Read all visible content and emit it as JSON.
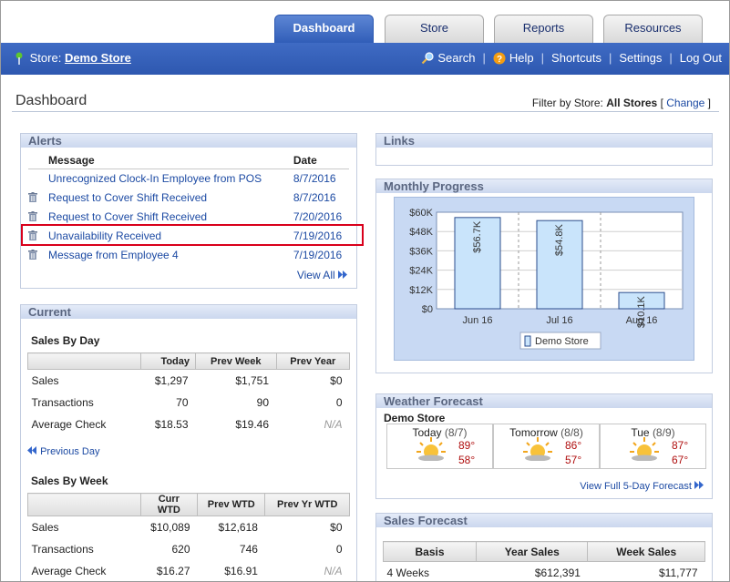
{
  "tabs": [
    {
      "label": "Dashboard",
      "active": true
    },
    {
      "label": "Store",
      "active": false
    },
    {
      "label": "Reports",
      "active": false
    },
    {
      "label": "Resources",
      "active": false
    }
  ],
  "topbar": {
    "store_prefix": "Store:",
    "store_name": "Demo Store",
    "links": [
      "Search",
      "Help",
      "Shortcuts",
      "Settings",
      "Log Out"
    ]
  },
  "page": {
    "title": "Dashboard",
    "filter_label": "Filter by Store:",
    "filter_value": "All Stores",
    "filter_open": "[",
    "filter_change": "Change",
    "filter_close": "]"
  },
  "alerts": {
    "title": "Alerts",
    "col_message": "Message",
    "col_date": "Date",
    "rows": [
      {
        "message": "Unrecognized Clock-In Employee from POS",
        "date": "8/7/2016",
        "trash": false
      },
      {
        "message": "Request to Cover Shift Received",
        "date": "8/7/2016",
        "trash": true
      },
      {
        "message": "Request to Cover Shift Received",
        "date": "7/20/2016",
        "trash": true
      },
      {
        "message": "Unavailability Received",
        "date": "7/19/2016",
        "trash": true,
        "highlight": true
      },
      {
        "message": "Message from Employee 4",
        "date": "7/19/2016",
        "trash": true
      }
    ],
    "view_all": "View All"
  },
  "current": {
    "title": "Current",
    "by_day": {
      "title": "Sales By Day",
      "headers": [
        "",
        "Today",
        "Prev Week",
        "Prev Year"
      ],
      "rows": [
        [
          "Sales",
          "$1,297",
          "$1,751",
          "$0"
        ],
        [
          "Transactions",
          "70",
          "90",
          "0"
        ],
        [
          "Average Check",
          "$18.53",
          "$19.46",
          "N/A"
        ]
      ],
      "prev_link": "Previous Day"
    },
    "by_week": {
      "title": "Sales By Week",
      "headers": [
        "",
        "Curr WTD",
        "Prev WTD",
        "Prev Yr WTD"
      ],
      "rows": [
        [
          "Sales",
          "$10,089",
          "$12,618",
          "$0"
        ],
        [
          "Transactions",
          "620",
          "746",
          "0"
        ],
        [
          "Average Check",
          "$16.27",
          "$16.91",
          "N/A"
        ]
      ]
    }
  },
  "links": {
    "title": "Links"
  },
  "monthly": {
    "title": "Monthly Progress",
    "legend": "Demo Store"
  },
  "chart_data": {
    "type": "bar",
    "categories": [
      "Jun 16",
      "Jul 16",
      "Aug 16"
    ],
    "series": [
      {
        "name": "Demo Store",
        "values": [
          56.7,
          54.8,
          10.1
        ]
      }
    ],
    "value_labels": [
      "$56.7K",
      "$54.8K",
      "$10.1K"
    ],
    "y_ticks": [
      "$0",
      "$12K",
      "$24K",
      "$36K",
      "$48K",
      "$60K"
    ],
    "ylim": [
      0,
      60
    ],
    "legend": "bottom"
  },
  "weather": {
    "title": "Weather Forecast",
    "store": "Demo Store",
    "days": [
      {
        "name": "Today",
        "date": "(8/7)",
        "hi": "89°",
        "lo": "58°"
      },
      {
        "name": "Tomorrow",
        "date": "(8/8)",
        "hi": "86°",
        "lo": "57°"
      },
      {
        "name": "Tue",
        "date": "(8/9)",
        "hi": "87°",
        "lo": "67°"
      }
    ],
    "view_full": "View Full 5-Day Forecast"
  },
  "sales_forecast": {
    "title": "Sales Forecast",
    "headers": [
      "Basis",
      "Year Sales",
      "Week Sales"
    ],
    "rows": [
      [
        "4 Weeks",
        "$612,391",
        "$11,777"
      ]
    ]
  },
  "colors": {
    "accent": "#2f5cb7",
    "link": "#1c4aa3",
    "highlight": "#d9001b",
    "bar": "#c9e4fb"
  }
}
